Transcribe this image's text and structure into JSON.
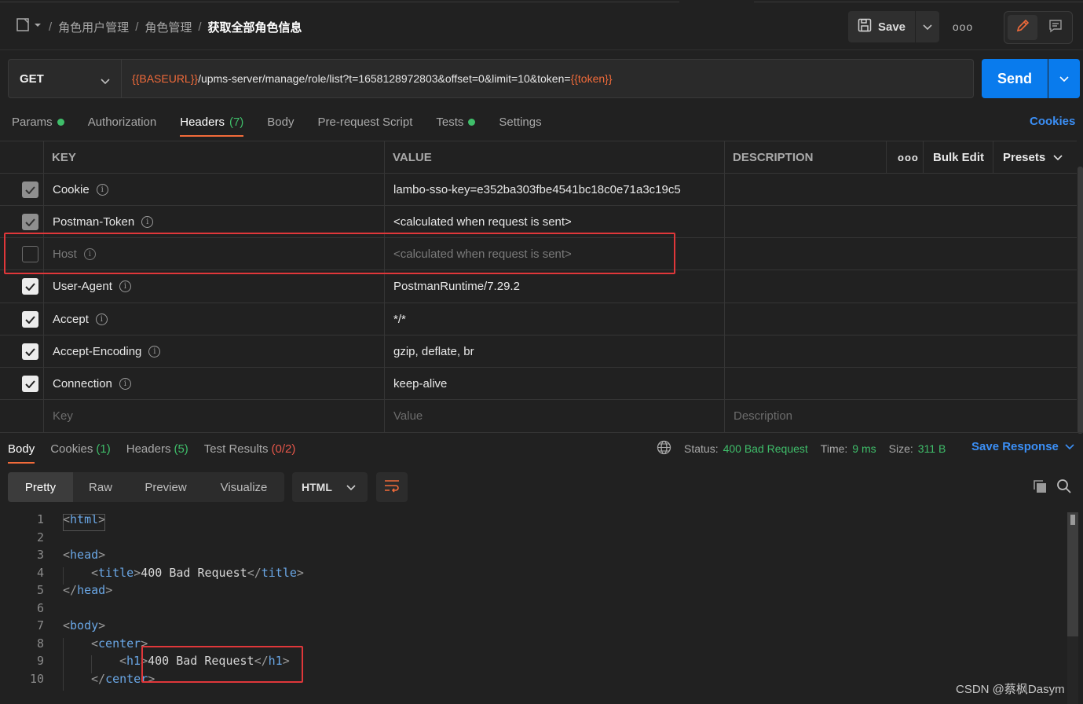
{
  "breadcrumb": {
    "items": [
      "角色用户管理",
      "角色管理"
    ],
    "current": "获取全部角色信息",
    "separator": "/"
  },
  "toolbar": {
    "save_label": "Save",
    "more_label": "ooo"
  },
  "request": {
    "method": "GET",
    "url_parts": [
      {
        "text": "{{BASEURL}}",
        "var": true
      },
      {
        "text": "/upms-server/manage/role/list?t=1658128972803&offset=0&limit=10&token=",
        "var": false
      },
      {
        "text": "{{token}}",
        "var": true
      }
    ],
    "send_label": "Send"
  },
  "request_tabs": [
    {
      "label": "Params",
      "dot": true
    },
    {
      "label": "Authorization"
    },
    {
      "label": "Headers",
      "count": "(7)",
      "active": true
    },
    {
      "label": "Body"
    },
    {
      "label": "Pre-request Script"
    },
    {
      "label": "Tests",
      "dot": true
    },
    {
      "label": "Settings"
    }
  ],
  "cookies_link": "Cookies",
  "headers_table": {
    "columns": {
      "key": "KEY",
      "value": "VALUE",
      "description": "DESCRIPTION"
    },
    "more_label": "ooo",
    "bulk_edit": "Bulk Edit",
    "presets": "Presets",
    "rows": [
      {
        "key": "Cookie",
        "value": "lambo-sso-key=e352ba303fbe4541bc18c0e71a3c19c5",
        "state": "grey"
      },
      {
        "key": "Postman-Token",
        "value": "<calculated when request is sent>",
        "state": "grey"
      },
      {
        "key": "Host",
        "value": "<calculated when request is sent>",
        "state": "off"
      },
      {
        "key": "User-Agent",
        "value": "PostmanRuntime/7.29.2",
        "state": "on"
      },
      {
        "key": "Accept",
        "value": "*/*",
        "state": "on"
      },
      {
        "key": "Accept-Encoding",
        "value": "gzip, deflate, br",
        "state": "on"
      },
      {
        "key": "Connection",
        "value": "keep-alive",
        "state": "on"
      }
    ],
    "placeholders": {
      "key": "Key",
      "value": "Value",
      "description": "Description"
    }
  },
  "response": {
    "tabs": [
      {
        "label": "Body",
        "active": true
      },
      {
        "label": "Cookies",
        "count": "(1)",
        "tone": "g"
      },
      {
        "label": "Headers",
        "count": "(5)",
        "tone": "g"
      },
      {
        "label": "Test Results",
        "count": "(0/2)",
        "tone": "r"
      }
    ],
    "status_label": "Status:",
    "status_value": "400 Bad Request",
    "time_label": "Time:",
    "time_value": "9 ms",
    "size_label": "Size:",
    "size_value": "311 B",
    "save_response": "Save Response",
    "views": [
      "Pretty",
      "Raw",
      "Preview",
      "Visualize"
    ],
    "format": "HTML",
    "code_lines": [
      {
        "n": "1",
        "indent": 0,
        "open": "html",
        "close": "",
        "text": ""
      },
      {
        "n": "2",
        "indent": 0,
        "open": "",
        "close": "",
        "text": ""
      },
      {
        "n": "3",
        "indent": 0,
        "open": "head",
        "close": "",
        "text": ""
      },
      {
        "n": "4",
        "indent": 1,
        "open": "title",
        "close": "title",
        "text": "400 Bad Request"
      },
      {
        "n": "5",
        "indent": 0,
        "open": "",
        "close": "head",
        "text": ""
      },
      {
        "n": "6",
        "indent": 0,
        "open": "",
        "close": "",
        "text": ""
      },
      {
        "n": "7",
        "indent": 0,
        "open": "body",
        "close": "",
        "text": ""
      },
      {
        "n": "8",
        "indent": 1,
        "open": "center",
        "close": "",
        "text": ""
      },
      {
        "n": "9",
        "indent": 2,
        "open": "h1",
        "close": "h1",
        "text": "400 Bad Request"
      },
      {
        "n": "10",
        "indent": 1,
        "open": "",
        "close": "center",
        "text": ""
      }
    ]
  },
  "watermark": "CSDN @蔡枫Dasym",
  "colors": {
    "accent_orange": "#f26b3a",
    "send_blue": "#097bed",
    "link_blue": "#3b8ff6",
    "success_green": "#3fbe6a",
    "error_red": "#e8574a",
    "annotation_red": "#e0373a"
  }
}
